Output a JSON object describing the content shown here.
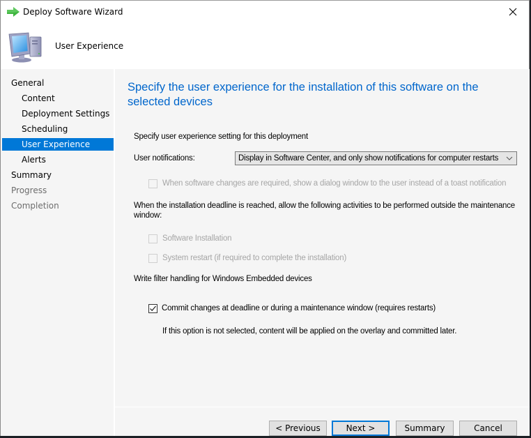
{
  "window": {
    "title": "Deploy Software Wizard",
    "header_title": "User Experience"
  },
  "nav": {
    "items": [
      {
        "label": "General",
        "level": 0,
        "state": "normal"
      },
      {
        "label": "Content",
        "level": 1,
        "state": "normal"
      },
      {
        "label": "Deployment Settings",
        "level": 1,
        "state": "normal"
      },
      {
        "label": "Scheduling",
        "level": 1,
        "state": "normal"
      },
      {
        "label": "User Experience",
        "level": 1,
        "state": "selected"
      },
      {
        "label": "Alerts",
        "level": 1,
        "state": "normal"
      },
      {
        "label": "Summary",
        "level": 0,
        "state": "normal"
      },
      {
        "label": "Progress",
        "level": 0,
        "state": "disabled"
      },
      {
        "label": "Completion",
        "level": 0,
        "state": "disabled"
      }
    ]
  },
  "main": {
    "heading": "Specify the user experience for the installation of this software on the selected devices",
    "section_label": "Specify user experience setting for this deployment",
    "user_notifications_label": "User notifications:",
    "user_notifications_value": "Display in Software Center, and only show notifications for computer restarts",
    "dialog_checkbox": {
      "label": "When software changes are required, show a dialog window to the user instead of a toast notification",
      "checked": false,
      "enabled": false
    },
    "deadline_label": "When the installation deadline is reached, allow the following activities to be performed outside the maintenance window:",
    "deadline_label_line1": "When the installation deadline is reached, allow the following activities to be performed outside the maintenance",
    "deadline_label_line2": "window:",
    "software_installation": {
      "label": "Software Installation",
      "checked": false,
      "enabled": false
    },
    "system_restart": {
      "label": "System restart  (if required to complete the installation)",
      "checked": false,
      "enabled": false
    },
    "write_filter_label": "Write filter handling for Windows Embedded devices",
    "commit_changes": {
      "label": "Commit changes at deadline or during a maintenance window (requires restarts)",
      "checked": true,
      "enabled": true
    },
    "commit_note": "If this option is not selected, content will be applied on the overlay and committed later."
  },
  "buttons": {
    "previous": "< Previous",
    "next": "Next >",
    "summary": "Summary",
    "cancel": "Cancel"
  },
  "colors": {
    "accent": "#0078d7",
    "heading": "#0066cc",
    "panel_bg": "#f5f5f5"
  }
}
